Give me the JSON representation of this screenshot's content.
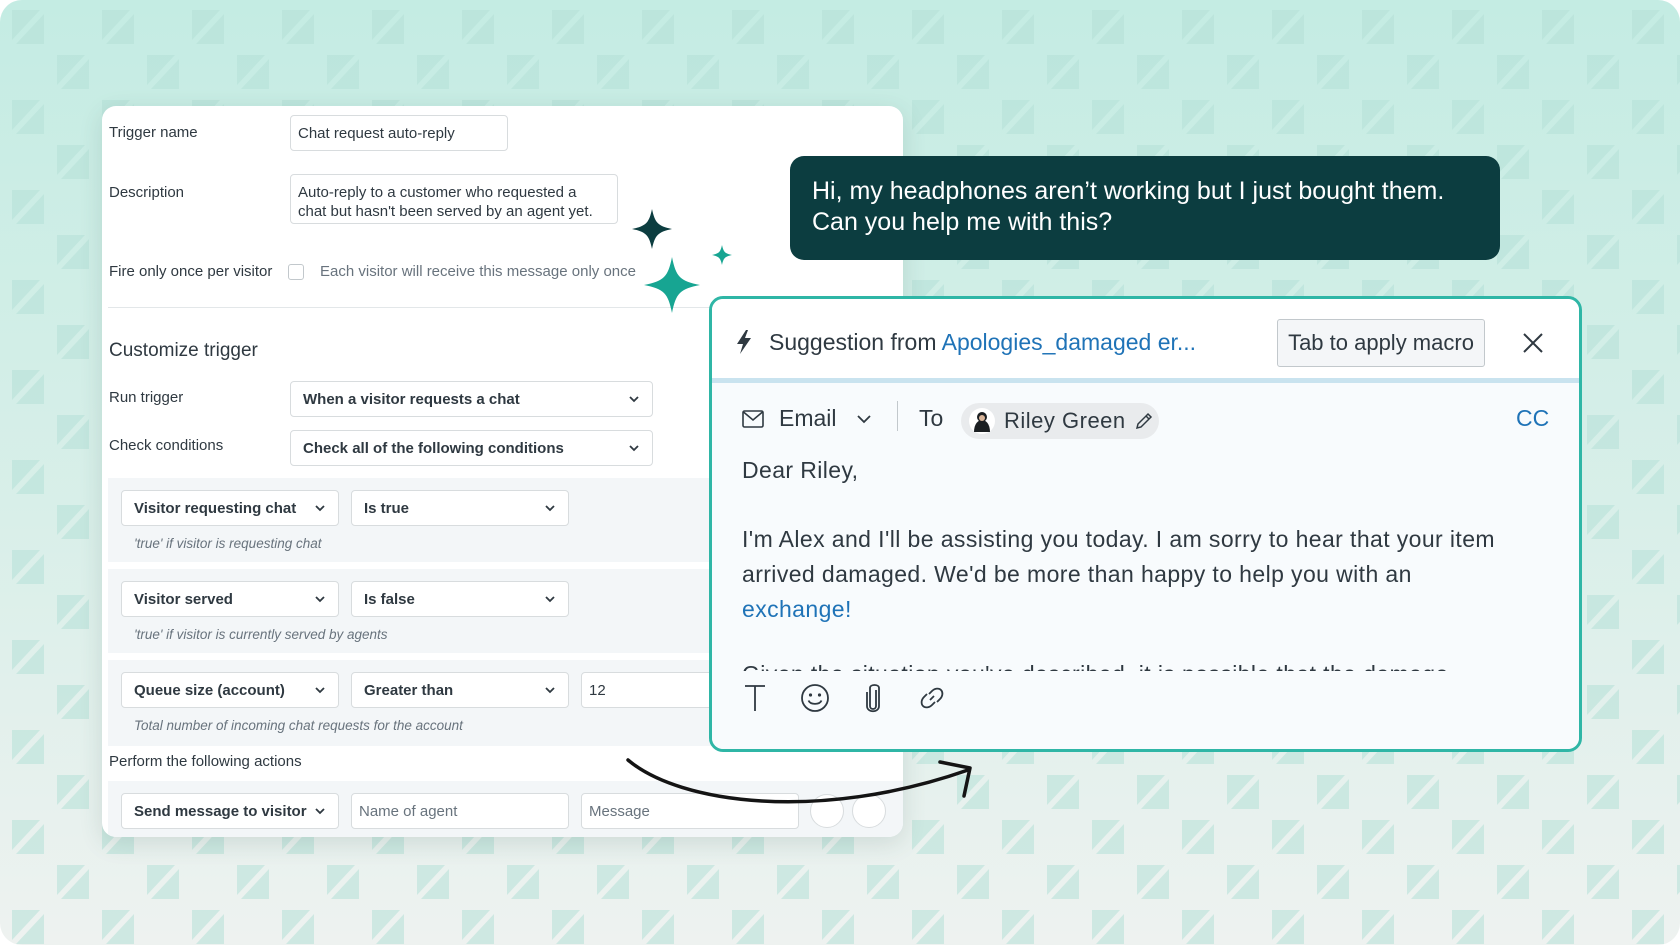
{
  "trigger_form": {
    "trigger_name_label": "Trigger name",
    "trigger_name_value": "Chat request auto-reply",
    "description_label": "Description",
    "description_line1": "Auto-reply to a customer who requested a",
    "description_line2": "chat but hasn't been served by an agent yet.",
    "fire_once_label": "Fire only once per visitor",
    "fire_once_hint": "Each visitor will receive this message only once",
    "customize_title": "Customize trigger",
    "run_trigger_label": "Run trigger",
    "run_trigger_value": "When a visitor requests a chat",
    "check_conditions_label": "Check conditions",
    "check_conditions_value": "Check all of the following conditions",
    "conditions": [
      {
        "field": "Visitor requesting chat",
        "operator": "Is true",
        "hint": "'true' if visitor is requesting chat"
      },
      {
        "field": "Visitor served",
        "operator": "Is false",
        "hint": "'true' if visitor is currently served by agents"
      },
      {
        "field": "Queue size (account)",
        "operator": "Greater than",
        "value": "12",
        "hint": "Total number of incoming chat requests for the account"
      }
    ],
    "actions_label": "Perform the following actions",
    "action": {
      "type": "Send message to visitor",
      "agent_placeholder": "Name of agent",
      "message_placeholder": "Message"
    }
  },
  "chat_bubble": {
    "line1": "Hi, my headphones aren’t working but I just bought them.",
    "line2": "Can you help me with this?"
  },
  "suggestion": {
    "prefix": "Suggestion from ",
    "macro_name": "Apologies_damaged er...",
    "apply_button": "Tab to apply macro",
    "channel": "Email",
    "to_label": "To",
    "recipient": "Riley Green",
    "cc_label": "CC",
    "greeting": "Dear Riley,",
    "body_line1": "I'm Alex and I'll be assisting you today. I am sorry to hear that your item",
    "body_line2": "arrived damaged. We'd be more than happy to help you with an",
    "body_link": "exchange",
    "body_link_suffix": "!",
    "body_cut": "Given the situation you've described, it is possible that the damage"
  },
  "colors": {
    "teal_border": "#2fb6a6",
    "bubble_bg": "#0c3d40",
    "link_blue": "#1f73b7",
    "sparkle": "#17a592",
    "sparkle_dark": "#0c3d40"
  }
}
